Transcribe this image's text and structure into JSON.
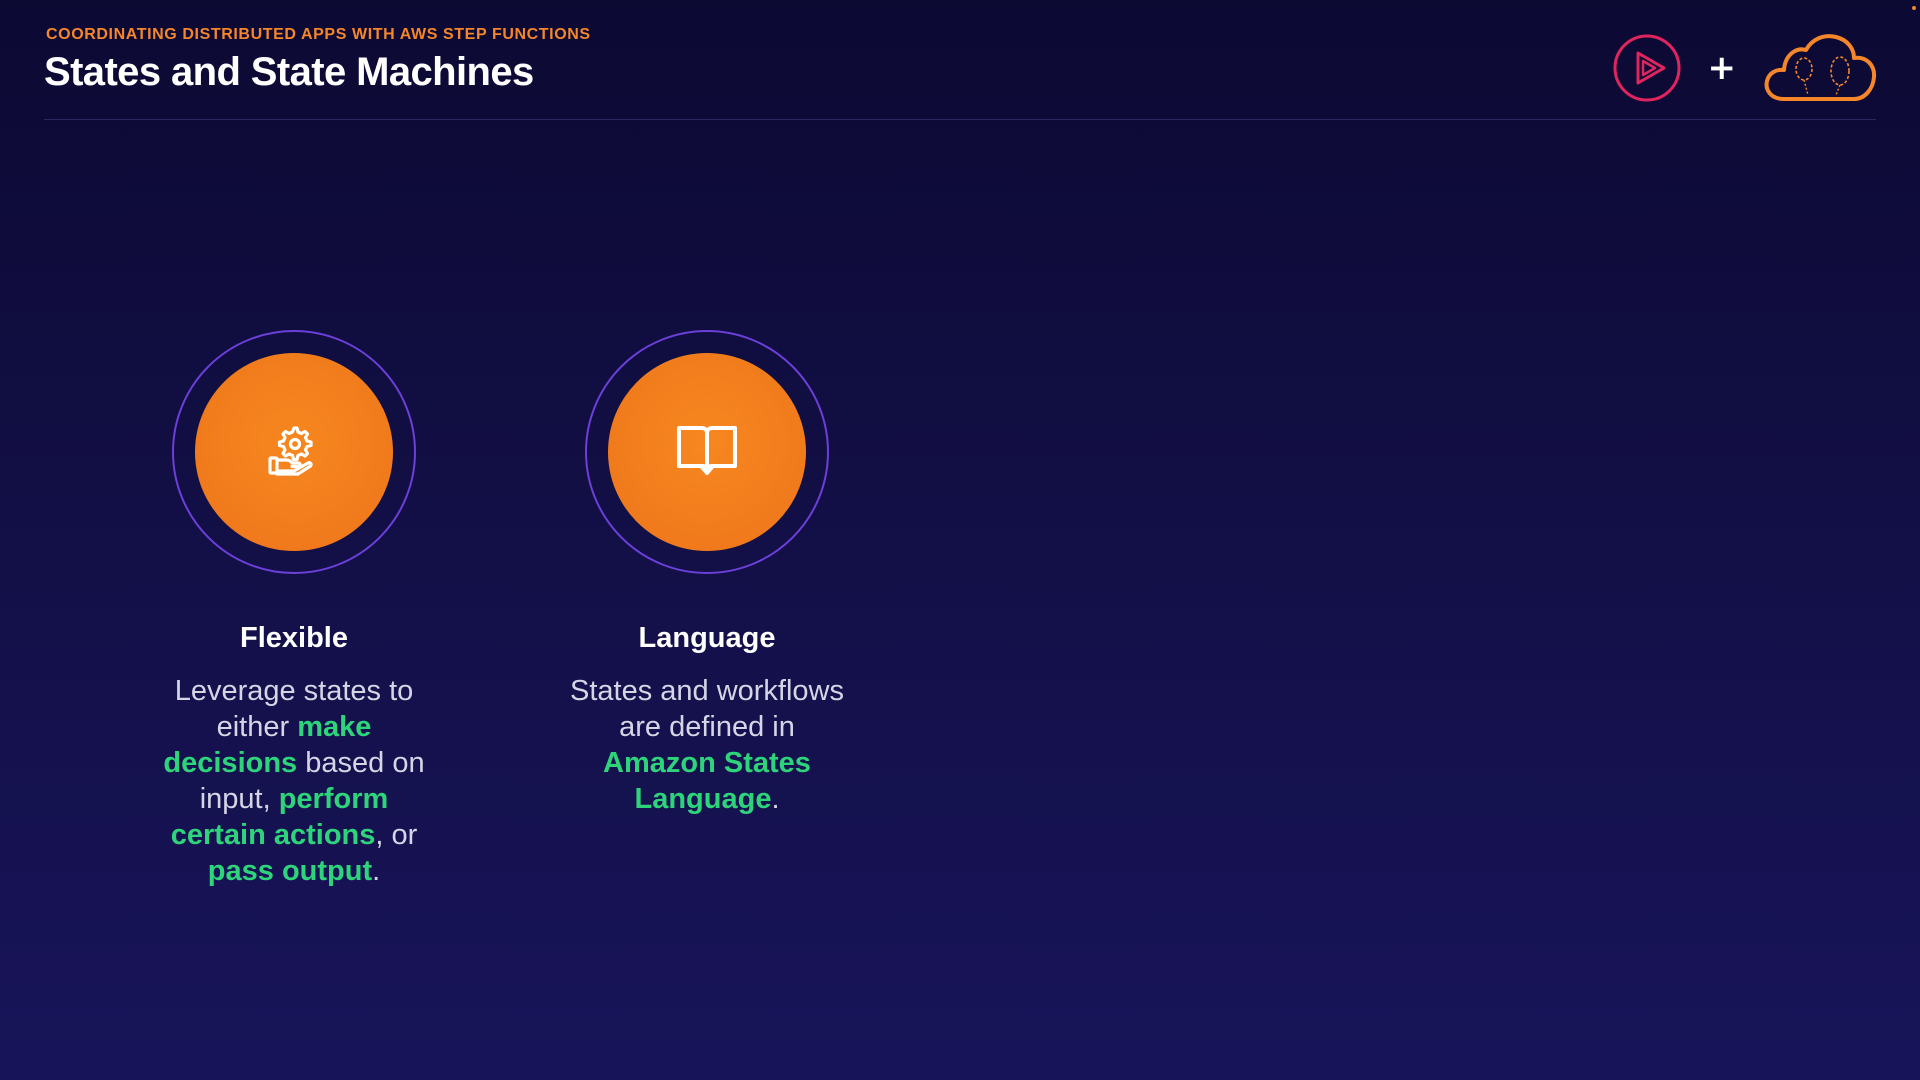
{
  "header": {
    "subtitle": "COORDINATING DISTRIBUTED APPS WITH AWS STEP FUNCTIONS",
    "title": "States and State Machines"
  },
  "logos": {
    "plus": "+",
    "play_logo_icon": "play-triangle-logo",
    "cloud_logo_icon": "cloud-balloon-logo"
  },
  "features": [
    {
      "icon": "hand-gear-icon",
      "title": "Flexible",
      "desc": {
        "t1": "Leverage states to either ",
        "h1": "make decisions",
        "t2": " based on input, ",
        "h2": "perform certain actions",
        "t3": ", or ",
        "h3": "pass output",
        "t4": "."
      }
    },
    {
      "icon": "open-book-icon",
      "title": "Language",
      "desc": {
        "t1": "States and workflows are defined in ",
        "h1": "Amazon States Language",
        "t2": "."
      }
    }
  ],
  "colors": {
    "background_top": "#0c0933",
    "background_bottom": "#18145a",
    "accent_orange": "#f5862a",
    "highlight_green": "#2ed47a",
    "ring_purple": "#6b3fd8",
    "play_red": "#e0245e"
  }
}
